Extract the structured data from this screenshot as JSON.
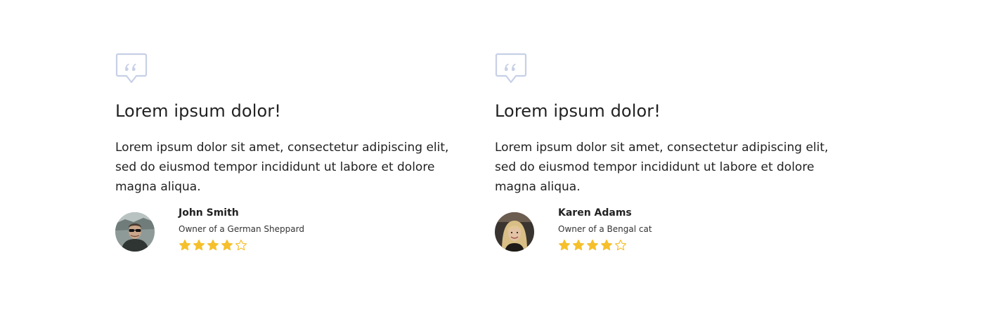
{
  "colors": {
    "star": "#f6c02c",
    "quote_icon": "#c7d0e6",
    "text": "#222222"
  },
  "testimonials": [
    {
      "icon": "quote-bubble-icon",
      "title": "Lorem ipsum dolor!",
      "body": "Lorem ipsum dolor sit amet, consectetur adipiscing elit, sed do eiusmod tempor incididunt ut labore et dolore magna aliqua.",
      "author": {
        "name": "John Smith",
        "role": "Owner of a German Sheppard",
        "avatar": "man-with-sunglasses-avatar"
      },
      "rating": 4,
      "rating_max": 5
    },
    {
      "icon": "quote-bubble-icon",
      "title": "Lorem ipsum dolor!",
      "body": "Lorem ipsum dolor sit amet, consectetur adipiscing elit, sed do eiusmod tempor incididunt ut labore et dolore magna aliqua.",
      "author": {
        "name": "Karen Adams",
        "role": "Owner of a Bengal cat",
        "avatar": "blonde-woman-avatar"
      },
      "rating": 4,
      "rating_max": 5
    }
  ]
}
